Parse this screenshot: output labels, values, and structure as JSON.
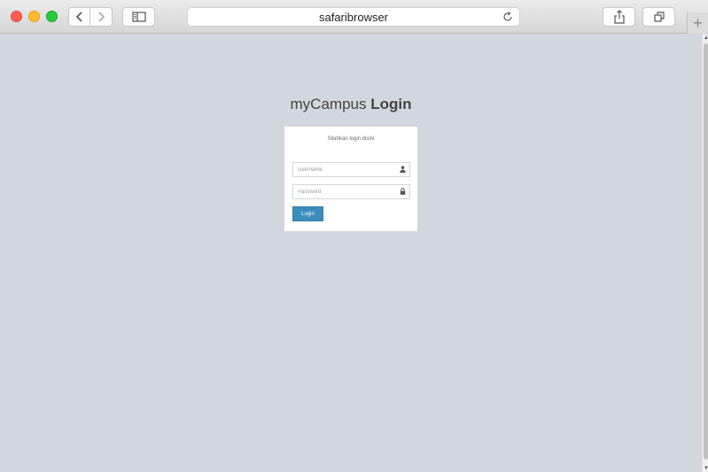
{
  "browser": {
    "address_text": "safaribrowser",
    "newtab_symbol": "+"
  },
  "page": {
    "logo_light": "myCampus",
    "logo_bold": "Login",
    "login_message": "Silahkan login disini",
    "username_placeholder": "Username",
    "password_placeholder": "Password",
    "login_button": "Login"
  },
  "colors": {
    "background": "#d2d6de",
    "button": "#3c8dbc"
  }
}
